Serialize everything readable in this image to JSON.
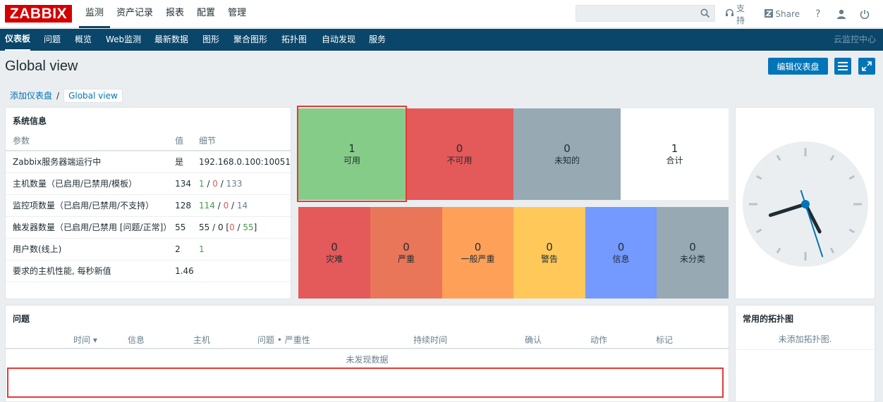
{
  "header": {
    "logo": "ZABBIX",
    "menu": [
      "监测",
      "资产记录",
      "报表",
      "配置",
      "管理"
    ],
    "search_placeholder": "",
    "support_label": "支持",
    "share_label": "Share",
    "help_label": "?"
  },
  "subnav": {
    "items": [
      "仪表板",
      "问题",
      "概览",
      "Web监测",
      "最新数据",
      "图形",
      "聚合图形",
      "拓扑图",
      "自动发现",
      "服务"
    ],
    "right": "云监控中心"
  },
  "page": {
    "title": "Global view",
    "edit_button": "编辑仪表盘"
  },
  "breadcrumb": {
    "parent": "添加仪表盘",
    "separator": "/",
    "current": "Global view"
  },
  "sysinfo": {
    "title": "系统信息",
    "headers": [
      "参数",
      "值",
      "细节"
    ],
    "rows": [
      {
        "param": "Zabbix服务器端运行中",
        "value": "是",
        "detail": "192.168.0.100:10051"
      },
      {
        "param": "主机数量（已启用/已禁用/模板）",
        "value": "134",
        "d1": "1",
        "d2": "0",
        "d3": "133"
      },
      {
        "param": "监控项数量（已启用/已禁用/不支持）",
        "value": "128",
        "d1": "114",
        "d2": "0",
        "d3": "14"
      },
      {
        "param": "触发器数量（已启用/已禁用 [问题/正常]）",
        "value": "55",
        "d1": "55",
        "d2": "0",
        "d3": "0",
        "d4": "55"
      },
      {
        "param": "用户数(线上)",
        "value": "2",
        "d1": "1"
      },
      {
        "param": "要求的主机性能, 每秒新值",
        "value": "1.46",
        "detail": ""
      }
    ],
    "separators": {
      "slash": " / ",
      "open": " [",
      "close": "]"
    }
  },
  "host_availability": [
    {
      "count": "1",
      "label": "可用",
      "color": "#86cc89"
    },
    {
      "count": "0",
      "label": "不可用",
      "color": "#e45959"
    },
    {
      "count": "0",
      "label": "未知的",
      "color": "#97aab3"
    },
    {
      "count": "1",
      "label": "合计",
      "color": "#ffffff"
    }
  ],
  "severity": [
    {
      "count": "0",
      "label": "灾难",
      "color": "#e45959"
    },
    {
      "count": "0",
      "label": "严重",
      "color": "#e97659"
    },
    {
      "count": "0",
      "label": "一般严重",
      "color": "#ffa059"
    },
    {
      "count": "0",
      "label": "警告",
      "color": "#ffc859"
    },
    {
      "count": "0",
      "label": "信息",
      "color": "#7499ff"
    },
    {
      "count": "0",
      "label": "未分类",
      "color": "#97aab3"
    }
  ],
  "problems": {
    "title": "问题",
    "columns": [
      "时间 ▾",
      "信息",
      "主机",
      "问题 • 严重性",
      "持续时间",
      "确认",
      "动作",
      "标记"
    ],
    "empty": "未发现数据"
  },
  "maps": {
    "title": "常用的拓扑图",
    "empty": "未添加拓扑图."
  },
  "clock": {
    "hour": 8,
    "minute": 25,
    "second": 27
  }
}
